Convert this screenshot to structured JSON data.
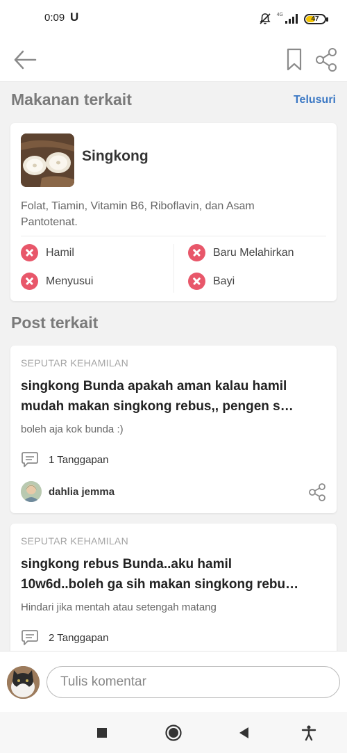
{
  "status_bar": {
    "time": "0:09",
    "indicator": "U",
    "network": "4G",
    "battery": "47"
  },
  "app_bar": {
    "back_icon": "arrow-left-icon",
    "bookmark_icon": "bookmark-icon",
    "share_icon": "share-icon"
  },
  "related_foods": {
    "title": "Makanan terkait",
    "browse_label": "Telusuri",
    "food": {
      "name": "Singkong",
      "description": "Folat, Tiamin, Vitamin B6, Riboflavin, dan Asam Pantotenat.",
      "tags": [
        {
          "label": "Hamil",
          "status": "not-recommended"
        },
        {
          "label": "Baru Melahirkan",
          "status": "not-recommended"
        },
        {
          "label": "Menyusui",
          "status": "not-recommended"
        },
        {
          "label": "Bayi",
          "status": "not-recommended"
        }
      ]
    }
  },
  "related_posts": {
    "title": "Post terkait",
    "posts": [
      {
        "category": "SEPUTAR KEHAMILAN",
        "title_line1": "singkong Bunda apakah aman kalau hamil",
        "title_line2": "mudah makan singkong rebus,,  pengen s…",
        "body": "boleh aja kok bunda :)",
        "replies": "1 Tanggapan",
        "author": "dahlia jemma"
      },
      {
        "category": "SEPUTAR KEHAMILAN",
        "title_line1": "singkong rebus Bunda..aku hamil",
        "title_line2": "10w6d..boleh ga sih makan singkong rebu…",
        "body": "Hindari jika mentah atau setengah matang",
        "replies": "2 Tanggapan"
      }
    ]
  },
  "comment": {
    "placeholder": "Tulis komentar"
  },
  "colors": {
    "accent_link": "#3b78c4",
    "danger": "#e8576a",
    "background": "#f2f2f2"
  }
}
